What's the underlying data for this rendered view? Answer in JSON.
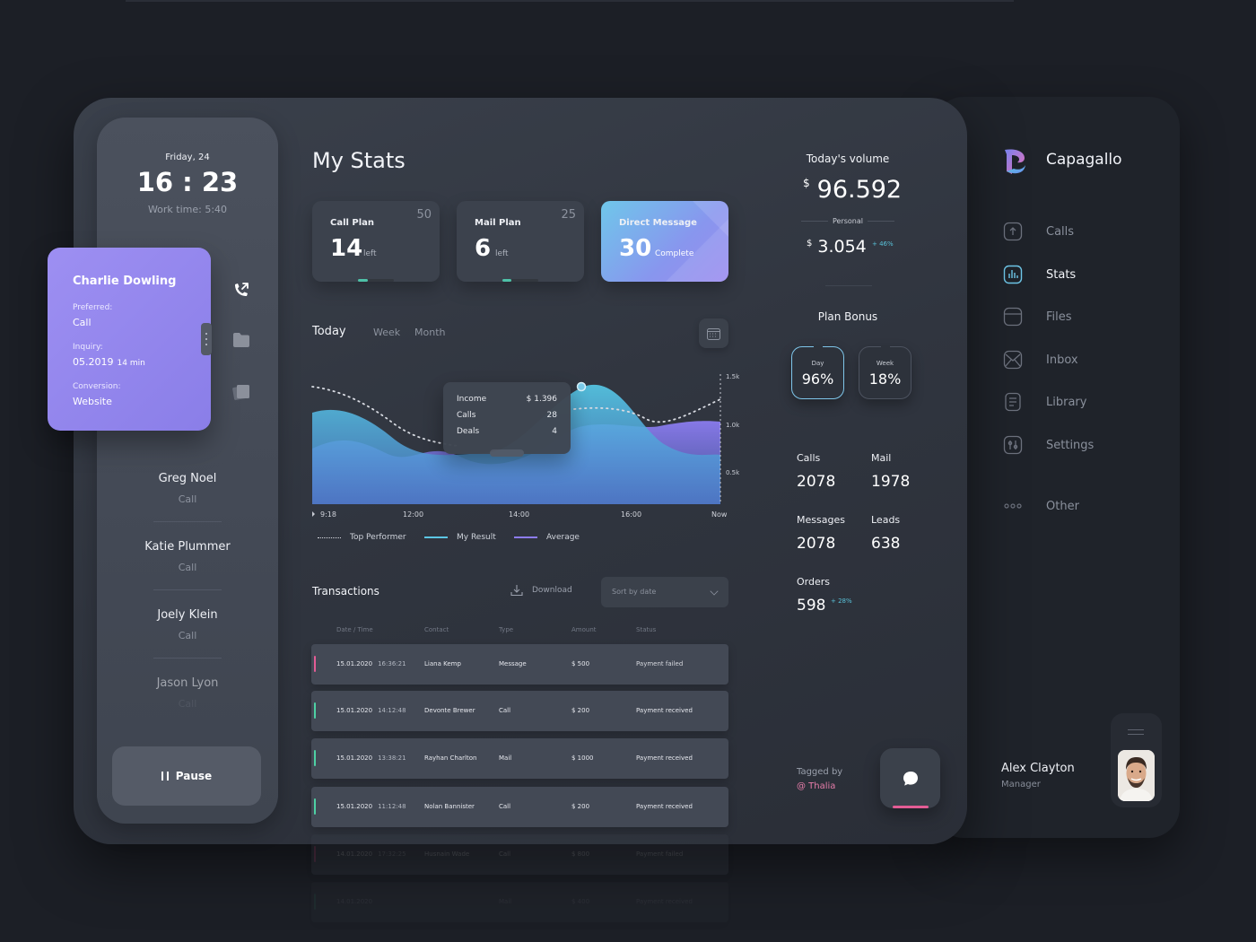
{
  "brand": {
    "name": "Capagallo"
  },
  "nav": {
    "items": [
      {
        "label": "Calls",
        "icon": "calls-icon",
        "active": false
      },
      {
        "label": "Stats",
        "icon": "stats-icon",
        "active": true
      },
      {
        "label": "Files",
        "icon": "files-icon",
        "active": false
      },
      {
        "label": "Inbox",
        "icon": "inbox-icon",
        "active": false
      },
      {
        "label": "Library",
        "icon": "library-icon",
        "active": false
      },
      {
        "label": "Settings",
        "icon": "settings-icon",
        "active": false
      },
      {
        "label": "Other",
        "icon": "more-icon",
        "active": false
      }
    ]
  },
  "profile": {
    "name": "Alex Clayton",
    "role": "Manager"
  },
  "clock": {
    "date": "Friday, 24",
    "time": "16 : 23",
    "work_time": "Work time: 5:40"
  },
  "contact_card": {
    "name": "Charlie Dowling",
    "preferred_label": "Preferred:",
    "preferred_value": "Call",
    "inquiry_label": "Inquiry:",
    "inquiry_date": "05.2019",
    "inquiry_duration": "14 min",
    "conversion_label": "Conversion:",
    "conversion_value": "Website"
  },
  "people": [
    {
      "name": "Greg Noel",
      "type": "Call"
    },
    {
      "name": "Katie Plummer",
      "type": "Call"
    },
    {
      "name": "Joely Klein",
      "type": "Call"
    },
    {
      "name": "Jason Lyon",
      "type": "Call"
    }
  ],
  "pause_label": "Pause",
  "page_title": "My Stats",
  "plans": [
    {
      "label": "Call Plan",
      "max": "50",
      "value": "14",
      "unit": "left",
      "progress": 0.28
    },
    {
      "label": "Mail Plan",
      "max": "25",
      "value": "6",
      "unit": "left",
      "progress": 0.24
    },
    {
      "label": "Direct Message",
      "value": "30",
      "unit": "Complete"
    }
  ],
  "tabs": [
    "Today",
    "Week",
    "Month"
  ],
  "chart_data": {
    "type": "area",
    "x_ticks": [
      "9:18",
      "12:00",
      "14:00",
      "16:00",
      "Now"
    ],
    "y_ticks": [
      "1.5k",
      "1.0k",
      "0.5k"
    ],
    "legend": [
      "Top Performer",
      "My Result",
      "Average"
    ],
    "series_colors": {
      "Top Performer": "#c9ccd4",
      "My Result": "#5cc6e4",
      "Average": "#8d7cf0"
    },
    "tooltip": [
      {
        "label": "Income",
        "value": "$ 1.396"
      },
      {
        "label": "Calls",
        "value": "28"
      },
      {
        "label": "Deals",
        "value": "4"
      }
    ]
  },
  "transactions": {
    "title": "Transactions",
    "download_label": "Download",
    "sort_label": "Sort by date",
    "columns": [
      "Date / Time",
      "Contact",
      "Type",
      "Amount",
      "Status"
    ],
    "rows": [
      {
        "date": "15.01.2020",
        "time": "16:36:21",
        "contact": "Liana Kemp",
        "type": "Message",
        "amount": "$ 500",
        "status": "Payment failed",
        "mark": "#e35c95"
      },
      {
        "date": "15.01.2020",
        "time": "14:12:48",
        "contact": "Devonte Brewer",
        "type": "Call",
        "amount": "$ 200",
        "status": "Payment received",
        "mark": "#4ed1a4"
      },
      {
        "date": "15.01.2020",
        "time": "13:38:21",
        "contact": "Rayhan Charlton",
        "type": "Mail",
        "amount": "$ 1000",
        "status": "Payment received",
        "mark": "#4ed1a4"
      },
      {
        "date": "15.01.2020",
        "time": "11:12:48",
        "contact": "Nolan Bannister",
        "type": "Call",
        "amount": "$ 200",
        "status": "Payment received",
        "mark": "#4ed1a4"
      },
      {
        "date": "14.01.2020",
        "time": "17:32:25",
        "contact": "Husnain Wade",
        "type": "Call",
        "amount": "$ 800",
        "status": "Payment failed",
        "mark": "#e35c95"
      },
      {
        "date": "14.01.2020",
        "time": "",
        "contact": "",
        "type": "Mail",
        "amount": "$ 400",
        "status": "Payment received",
        "mark": "#4ed1a4"
      }
    ]
  },
  "volume": {
    "title": "Today's volume",
    "currency": "$",
    "value": "96.592",
    "personal_label": "Personal",
    "personal_value": "3.054",
    "personal_growth": "+ 46%"
  },
  "plan_bonus": {
    "title": "Plan Bonus",
    "items": [
      {
        "label": "Day",
        "value": "96%"
      },
      {
        "label": "Week",
        "value": "18%"
      }
    ]
  },
  "metrics": [
    {
      "label": "Calls",
      "value": "2078"
    },
    {
      "label": "Mail",
      "value": "1978"
    },
    {
      "label": "Messages",
      "value": "2078"
    },
    {
      "label": "Leads",
      "value": "638"
    },
    {
      "label": "Orders",
      "value": "598",
      "growth": "+ 28%"
    }
  ],
  "tagged": {
    "label": "Tagged by",
    "value": "@ Thalia"
  },
  "colors": {
    "accent_purple": "#9d8ff2",
    "accent_blue": "#5cc6e4",
    "accent_pink": "#e35c95",
    "accent_green": "#4ed1a4"
  }
}
